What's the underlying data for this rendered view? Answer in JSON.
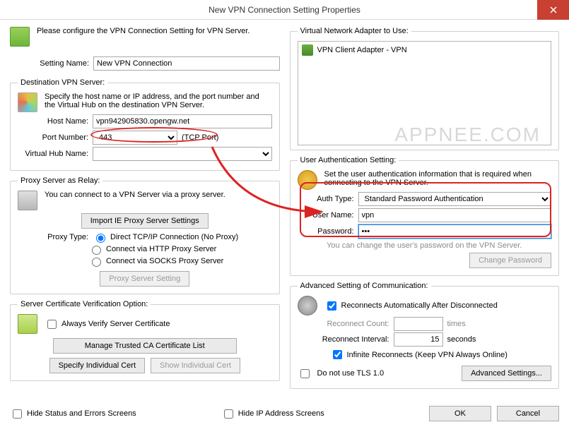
{
  "window": {
    "title": "New VPN Connection Setting Properties"
  },
  "intro": "Please configure the VPN Connection Setting for VPN Server.",
  "setting_name": {
    "label": "Setting Name:",
    "value": "New VPN Connection"
  },
  "dest": {
    "legend": "Destination VPN Server:",
    "hint": "Specify the host name or IP address, and the port number and the Virtual Hub on the destination VPN Server.",
    "host_label": "Host Name:",
    "host_value": "vpn942905830.opengw.net",
    "port_label": "Port Number:",
    "port_value": "443",
    "port_suffix": "(TCP Port)",
    "vhub_label": "Virtual Hub Name:",
    "vhub_value": ""
  },
  "proxy": {
    "legend": "Proxy Server as Relay:",
    "hint": "You can connect to a VPN Server via a proxy server.",
    "import_btn": "Import IE Proxy Server Settings",
    "type_label": "Proxy Type:",
    "opts": [
      "Direct TCP/IP Connection (No Proxy)",
      "Connect via HTTP Proxy Server",
      "Connect via SOCKS Proxy Server"
    ],
    "setting_btn": "Proxy Server Setting"
  },
  "cert": {
    "legend": "Server Certificate Verification Option:",
    "always": "Always Verify Server Certificate",
    "manage_btn": "Manage Trusted CA Certificate List",
    "spec_btn": "Specify Individual Cert",
    "show_btn": "Show Individual Cert"
  },
  "hide_status": "Hide Status and Errors Screens",
  "hide_ip": "Hide IP Address Screens",
  "adapter": {
    "legend": "Virtual Network Adapter to Use:",
    "item": "VPN Client Adapter - VPN"
  },
  "auth": {
    "legend": "User Authentication Setting:",
    "hint": "Set the user authentication information that is required when connecting to the VPN Server.",
    "type_label": "Auth Type:",
    "type_value": "Standard Password Authentication",
    "user_label": "User Name:",
    "user_value": "vpn",
    "pass_label": "Password:",
    "pass_value": "•••",
    "note": "You can change the user's password on the VPN Server.",
    "change_btn": "Change Password"
  },
  "adv": {
    "legend": "Advanced Setting of Communication:",
    "reconnect_auto": "Reconnects Automatically After Disconnected",
    "count_label": "Reconnect Count:",
    "count_suffix": "times",
    "interval_label": "Reconnect Interval:",
    "interval_value": "15",
    "interval_suffix": "seconds",
    "infinite": "Infinite Reconnects (Keep VPN Always Online)",
    "notls": "Do not use TLS 1.0",
    "adv_btn": "Advanced Settings..."
  },
  "buttons": {
    "ok": "OK",
    "cancel": "Cancel"
  },
  "watermark": "APPNEE.COM"
}
